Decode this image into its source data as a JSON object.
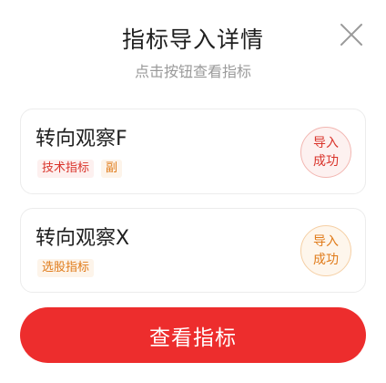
{
  "dialog": {
    "title": "指标导入详情",
    "subtitle": "点击按钮查看指标",
    "close_icon": "close-icon"
  },
  "indicators": [
    {
      "name": "转向观察F",
      "tags": [
        "技术指标",
        "副"
      ],
      "status": [
        "导入",
        "成功"
      ],
      "theme": "red"
    },
    {
      "name": "转向观察X",
      "tags": [
        "选股指标"
      ],
      "status": [
        "导入",
        "成功"
      ],
      "theme": "orange"
    }
  ],
  "actions": {
    "view_label": "查看指标"
  },
  "colors": {
    "primary_red": "#ed2d2d",
    "tag_red": "#d9342b",
    "tag_orange": "#e07b1a"
  }
}
